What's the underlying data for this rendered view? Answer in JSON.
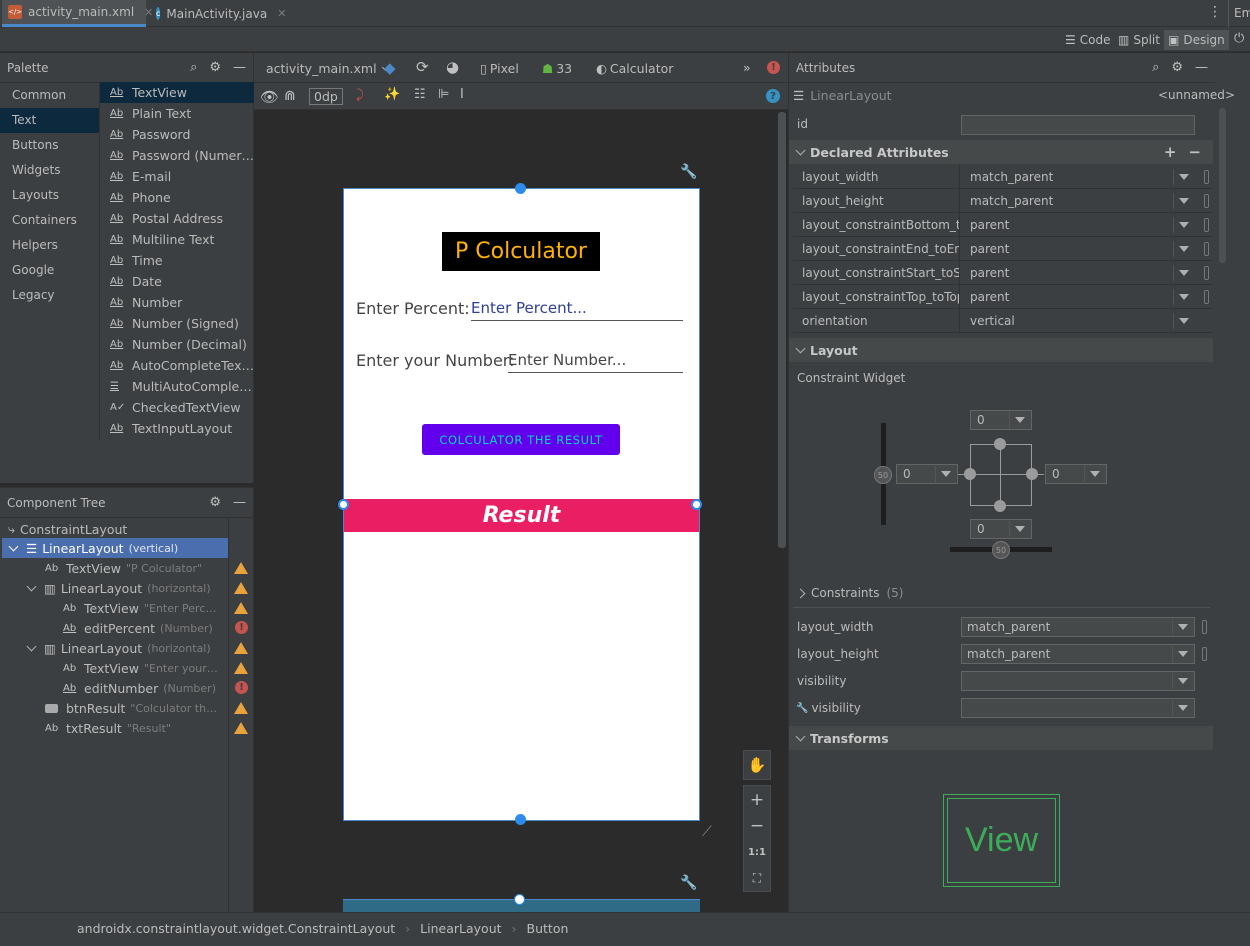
{
  "tabs": [
    {
      "label": "activity_main.xml",
      "active": true
    },
    {
      "label": "MainActivity.java",
      "active": false
    }
  ],
  "tabbar_right": "Em",
  "view_modes": {
    "code": "Code",
    "split": "Split",
    "design": "Design"
  },
  "palette": {
    "title": "Palette",
    "categories": [
      "Common",
      "Text",
      "Buttons",
      "Widgets",
      "Layouts",
      "Containers",
      "Helpers",
      "Google",
      "Legacy"
    ],
    "items": [
      "TextView",
      "Plain Text",
      "Password",
      "Password (Numer…",
      "E-mail",
      "Phone",
      "Postal Address",
      "Multiline Text",
      "Time",
      "Date",
      "Number",
      "Number (Signed)",
      "Number (Decimal)",
      "AutoCompleteTex…",
      "MultiAutoComple…",
      "CheckedTextView",
      "TextInputLayout"
    ]
  },
  "tree": {
    "title": "Component Tree",
    "rows": [
      {
        "label": "ConstraintLayout",
        "hint": ""
      },
      {
        "label": "LinearLayout",
        "hint": "(vertical)"
      },
      {
        "label": "TextView",
        "hint": "\"P Colculator\""
      },
      {
        "label": "LinearLayout",
        "hint": "(horizontal)"
      },
      {
        "label": "TextView",
        "hint": "\"Enter Perc…"
      },
      {
        "label": "editPercent",
        "hint": "(Number)"
      },
      {
        "label": "LinearLayout",
        "hint": "(horizontal)"
      },
      {
        "label": "TextView",
        "hint": "\"Enter your…"
      },
      {
        "label": "editNumber",
        "hint": "(Number)"
      },
      {
        "label": "btnResult",
        "hint": "\"Colculator th…"
      },
      {
        "label": "txtResult",
        "hint": "\"Result\""
      }
    ]
  },
  "canvas_toolbar": {
    "file": "activity_main.xml",
    "device": "Pixel",
    "api": "33",
    "theme": "Calculator",
    "margin": "0dp"
  },
  "phone": {
    "title": "P Colculator",
    "percent_label": "Enter Percent:",
    "percent_hint": "Enter Percent...",
    "number_label": "Enter your Number:",
    "number_hint": "Enter Number...",
    "button": "COLCULATOR THE RESULT",
    "result": "Result"
  },
  "zoom": {
    "one_to_one": "1:1"
  },
  "attributes": {
    "title": "Attributes",
    "component": "LinearLayout",
    "component_name": "<unnamed>",
    "id_label": "id",
    "declared_title": "Declared Attributes",
    "declared": [
      {
        "key": "layout_width",
        "value": "match_parent"
      },
      {
        "key": "layout_height",
        "value": "match_parent"
      },
      {
        "key": "layout_constraintBottom_toB…",
        "value": "parent"
      },
      {
        "key": "layout_constraintEnd_toEndOf",
        "value": "parent"
      },
      {
        "key": "layout_constraintStart_toStar…",
        "value": "parent"
      },
      {
        "key": "layout_constraintTop_toTopOf",
        "value": "parent"
      },
      {
        "key": "orientation",
        "value": "vertical"
      }
    ],
    "layout_title": "Layout",
    "constraint_widget": "Constraint Widget",
    "margins": {
      "top": "0",
      "left": "0",
      "right": "0",
      "bottom": "0"
    },
    "bias": "50",
    "constraints_title": "Constraints",
    "constraints_count": "(5)",
    "layout_rows": [
      {
        "key": "layout_width",
        "value": "match_parent"
      },
      {
        "key": "layout_height",
        "value": "match_parent"
      },
      {
        "key": "visibility",
        "value": ""
      },
      {
        "key": "visibility",
        "value": ""
      }
    ],
    "transforms_title": "Transforms",
    "view_preview": "View"
  },
  "breadcrumb": [
    "androidx.constraintlayout.widget.ConstraintLayout",
    "LinearLayout",
    "Button"
  ],
  "colors": {
    "title_bg": "#000000",
    "title_text": "#ffb300",
    "button_bg": "#6200ee",
    "button_text": "#03dac5",
    "result_bg": "#e91e63",
    "selection": "#2d8ceb",
    "warning": "#e8a33d",
    "error": "#c75450"
  }
}
